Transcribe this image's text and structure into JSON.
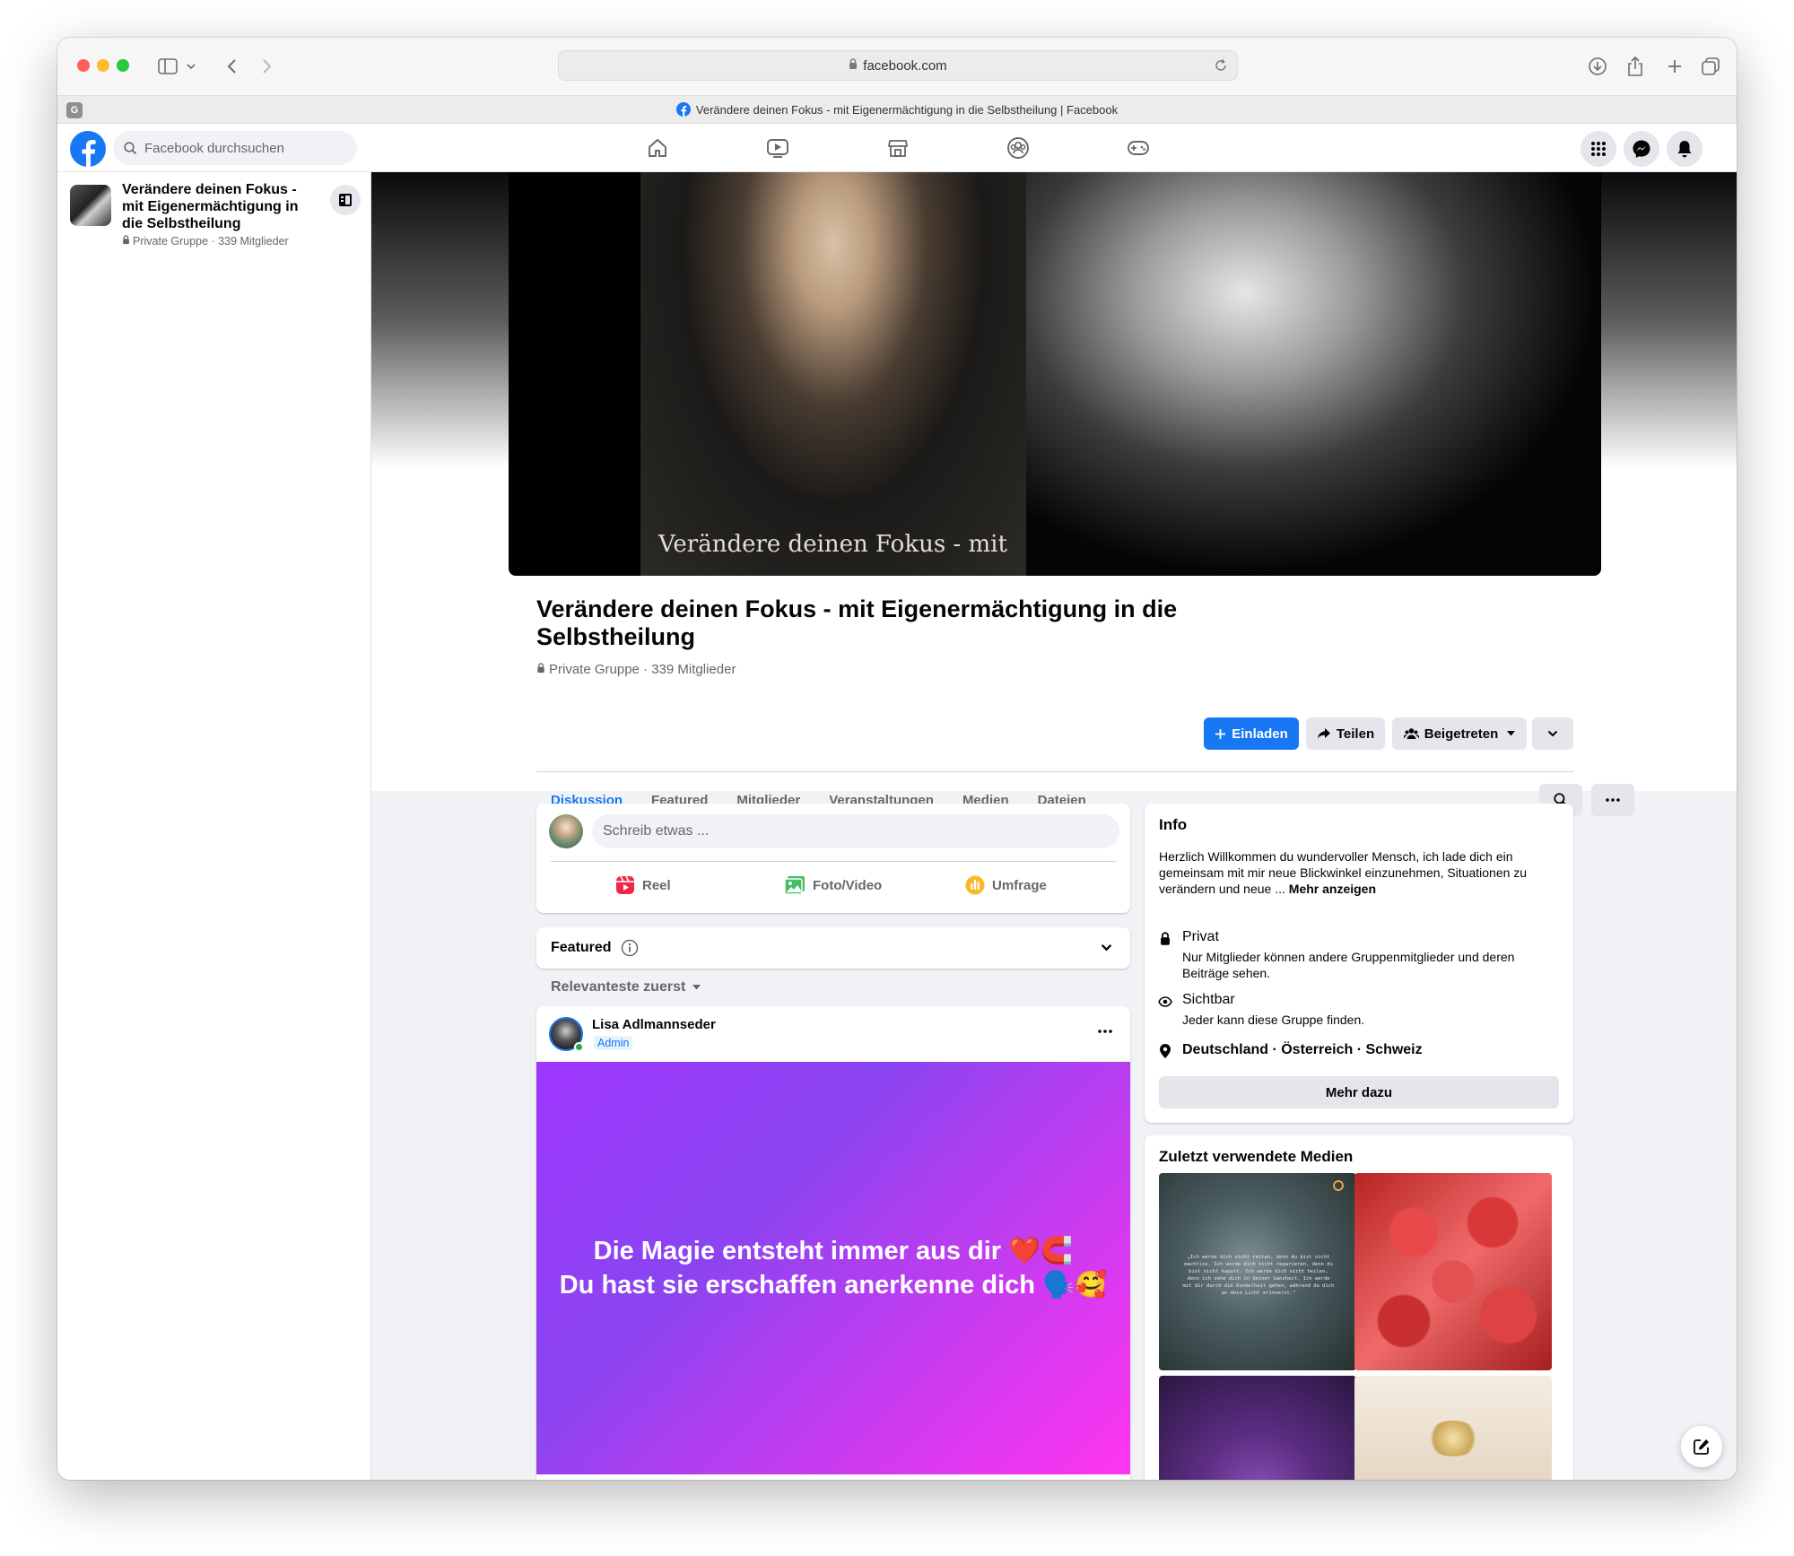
{
  "browser": {
    "url": "facebook.com",
    "tab_title": "Verändere deinen Fokus - mit Eigenermächtigung in die Selbstheilung | Facebook",
    "pinned_tab_letter": "G"
  },
  "fb_nav": {
    "search_placeholder": "Facebook durchsuchen"
  },
  "sidebar": {
    "group_title": "Verändere deinen Fokus - mit Eigenermächtigung in die Selbstheilung",
    "group_meta": "Private Gruppe · 339 Mitglieder"
  },
  "cover": {
    "text": "Verändere deinen Fokus - mit"
  },
  "group": {
    "title": "Verändere deinen Fokus - mit Eigenermächtigung in die Selbstheilung",
    "meta": "Private Gruppe · 339 Mitglieder",
    "invite_label": "Einladen",
    "share_label": "Teilen",
    "joined_label": "Beigetreten"
  },
  "tabs": [
    "Diskussion",
    "Featured",
    "Mitglieder",
    "Veranstaltungen",
    "Medien",
    "Dateien"
  ],
  "composer": {
    "placeholder": "Schreib etwas ...",
    "reel": "Reel",
    "photo": "Foto/Video",
    "poll": "Umfrage"
  },
  "featured": {
    "label": "Featured"
  },
  "sort": {
    "label": "Relevanteste zuerst"
  },
  "post": {
    "author": "Lisa Adlmannseder",
    "role": "Admin",
    "line1": "Die Magie entsteht immer aus dir ❤️🧲",
    "line2": "Du hast sie erschaffen anerkenne dich 🗣️🥰"
  },
  "info": {
    "heading": "Info",
    "description": "Herzlich Willkommen du wundervoller Mensch, ich lade dich ein gemeinsam mit mir neue Blickwinkel einzunehmen, Situationen zu verändern und neue ...",
    "more": "Mehr anzeigen",
    "private_title": "Privat",
    "private_desc": "Nur Mitglieder können andere Gruppenmitglieder und deren Beiträge sehen.",
    "visible_title": "Sichtbar",
    "visible_desc": "Jeder kann diese Gruppe finden.",
    "location": "Deutschland · Österreich · Schweiz",
    "more_button": "Mehr dazu"
  },
  "media": {
    "heading": "Zuletzt verwendete Medien",
    "quote": "„Ich werde dich nicht retten, denn du bist nicht machtlos. Ich werde dich nicht reparieren, denn du bist nicht kaputt. Ich werde dich nicht heilen, denn ich sehe dich in deiner Ganzheit. Ich werde mit dir durch die Dunkelheit gehen, während du dich an dein Licht erinnerst.“"
  }
}
